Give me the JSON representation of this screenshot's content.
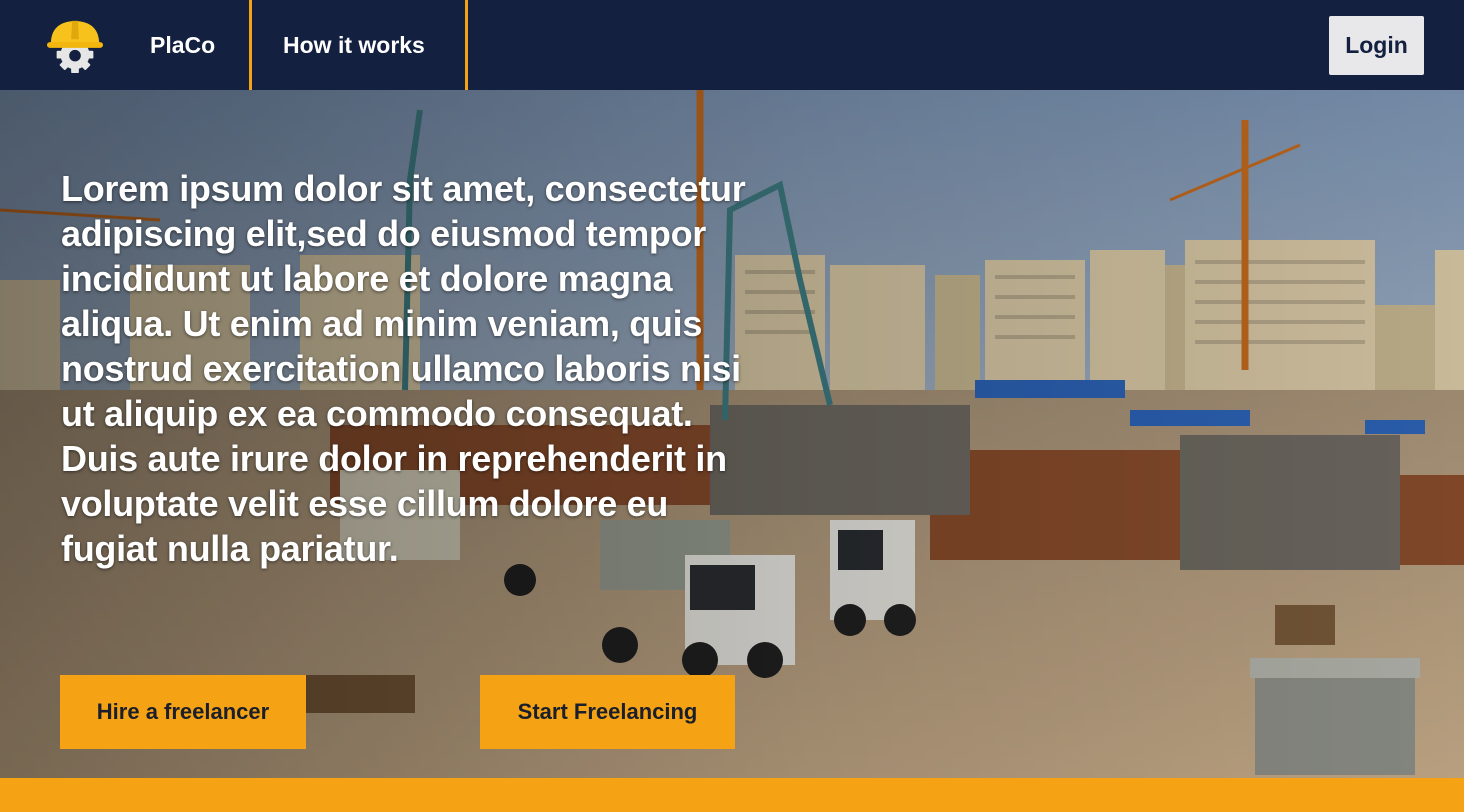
{
  "nav": {
    "brand": "PlaCo",
    "links": [
      "How it works"
    ],
    "login_label": "Login",
    "logo_icon": "helmet-gear-icon"
  },
  "hero": {
    "text": "Lorem ipsum dolor sit amet, consectetur adipiscing elit,sed do eiusmod tempor incididunt ut labore et dolore magna aliqua. Ut enim ad minim veniam, quis nostrud exercitation ullamco laboris nisi ut aliquip ex ea commodo consequat. Duis aute irure dolor in reprehenderit in voluptate velit esse cillum dolore eu fugiat nulla pariatur.",
    "buttons": [
      "Hire a freelancer",
      "Start Freelancing"
    ]
  },
  "colors": {
    "nav_bg": "#132040",
    "accent": "#f5a314",
    "login_bg": "#e8e8ea"
  }
}
